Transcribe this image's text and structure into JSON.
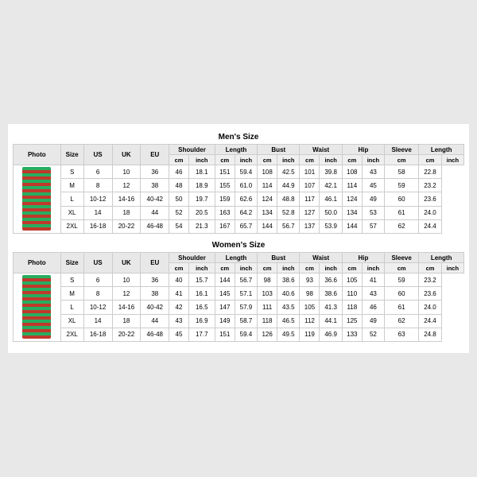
{
  "men": {
    "title": "Men's Size",
    "columns": {
      "fixed": [
        "Photo",
        "Size",
        "US",
        "UK",
        "EU"
      ],
      "measurement_groups": [
        "Shoulder",
        "Length",
        "Bust",
        "Waist",
        "Hip",
        "Sleeve",
        "Length"
      ],
      "units": [
        "cm",
        "inch",
        "cm",
        "inch",
        "cm",
        "inch",
        "cm",
        "inch",
        "cm",
        "inch",
        "cm",
        "cm",
        "inch"
      ]
    },
    "rows": [
      {
        "size": "S",
        "us": "6",
        "uk": "10",
        "eu": "36",
        "vals": [
          "46",
          "18.1",
          "151",
          "59.4",
          "108",
          "42.5",
          "101",
          "39.8",
          "108",
          "43",
          "58",
          "22.8"
        ]
      },
      {
        "size": "M",
        "us": "8",
        "uk": "12",
        "eu": "38",
        "vals": [
          "48",
          "18.9",
          "155",
          "61.0",
          "114",
          "44.9",
          "107",
          "42.1",
          "114",
          "45",
          "59",
          "23.2"
        ]
      },
      {
        "size": "L",
        "us": "10-12",
        "uk": "14-16",
        "eu": "40-42",
        "vals": [
          "50",
          "19.7",
          "159",
          "62.6",
          "124",
          "48.8",
          "117",
          "46.1",
          "124",
          "49",
          "60",
          "23.6"
        ]
      },
      {
        "size": "XL",
        "us": "14",
        "uk": "18",
        "eu": "44",
        "vals": [
          "52",
          "20.5",
          "163",
          "64.2",
          "134",
          "52.8",
          "127",
          "50.0",
          "134",
          "53",
          "61",
          "24.0"
        ]
      },
      {
        "size": "2XL",
        "us": "16-18",
        "uk": "20-22",
        "eu": "46-48",
        "vals": [
          "54",
          "21.3",
          "167",
          "65.7",
          "144",
          "56.7",
          "137",
          "53.9",
          "144",
          "57",
          "62",
          "24.4"
        ]
      }
    ]
  },
  "women": {
    "title": "Women's Size",
    "columns": {
      "fixed": [
        "Photo",
        "Size",
        "US",
        "UK",
        "EU"
      ],
      "measurement_groups": [
        "Shoulder",
        "Length",
        "Bust",
        "Waist",
        "Hip",
        "Sleeve",
        "Length"
      ],
      "units": [
        "cm",
        "inch",
        "cm",
        "inch",
        "cm",
        "inch",
        "cm",
        "inch",
        "cm",
        "inch",
        "cm",
        "cm",
        "inch"
      ]
    },
    "rows": [
      {
        "size": "S",
        "us": "6",
        "uk": "10",
        "eu": "36",
        "vals": [
          "40",
          "15.7",
          "144",
          "56.7",
          "98",
          "38.6",
          "93",
          "36.6",
          "105",
          "41",
          "59",
          "23.2"
        ]
      },
      {
        "size": "M",
        "us": "8",
        "uk": "12",
        "eu": "38",
        "vals": [
          "41",
          "16.1",
          "145",
          "57.1",
          "103",
          "40.6",
          "98",
          "38.6",
          "110",
          "43",
          "60",
          "23.6"
        ]
      },
      {
        "size": "L",
        "us": "10-12",
        "uk": "14-16",
        "eu": "40-42",
        "vals": [
          "42",
          "16.5",
          "147",
          "57.9",
          "111",
          "43.5",
          "105",
          "41.3",
          "118",
          "46",
          "61",
          "24.0"
        ]
      },
      {
        "size": "XL",
        "us": "14",
        "uk": "18",
        "eu": "44",
        "vals": [
          "43",
          "16.9",
          "149",
          "58.7",
          "118",
          "46.5",
          "112",
          "44.1",
          "125",
          "49",
          "62",
          "24.4"
        ]
      },
      {
        "size": "2XL",
        "us": "16-18",
        "uk": "20-22",
        "eu": "46-48",
        "vals": [
          "45",
          "17.7",
          "151",
          "59.4",
          "126",
          "49.5",
          "119",
          "46.9",
          "133",
          "52",
          "63",
          "24.8"
        ]
      }
    ]
  }
}
